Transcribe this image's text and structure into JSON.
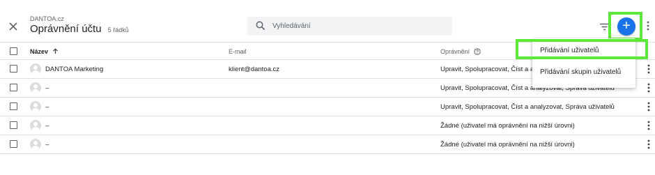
{
  "header": {
    "account_name": "DANTOA.cz",
    "title": "Oprávnění účtu",
    "row_count": "5 řádků"
  },
  "search": {
    "placeholder": "Vyhledávání"
  },
  "table": {
    "columns": {
      "name": "Název",
      "email": "E-mail",
      "permissions": "Oprávnění"
    },
    "rows": [
      {
        "name": "DANTOA Marketing",
        "email": "klient@dantoa.cz",
        "permissions": "Upravit, Spolupracovat, Číst a analyzovat, Správa uživatelů"
      },
      {
        "name": "–",
        "email": "",
        "permissions": "Upravit, Spolupracovat, Číst a analyzovat, Správa uživatelů"
      },
      {
        "name": "–",
        "email": "",
        "permissions": "Upravit, Spolupracovat, Číst a analyzovat, Správa uživatelů"
      },
      {
        "name": "–",
        "email": "",
        "permissions": "Žádné (uživatel má oprávnění na nižší úrovni)"
      },
      {
        "name": "–",
        "email": "",
        "permissions": "Žádné (uživatel má oprávnění na nižší úrovni)"
      }
    ]
  },
  "add_menu": {
    "items": [
      {
        "label": "Přidávání uživatelů"
      },
      {
        "label": "Přidávání skupin uživatelů"
      }
    ]
  },
  "colors": {
    "accent": "#1a73e8",
    "highlight": "#5ee83a"
  }
}
